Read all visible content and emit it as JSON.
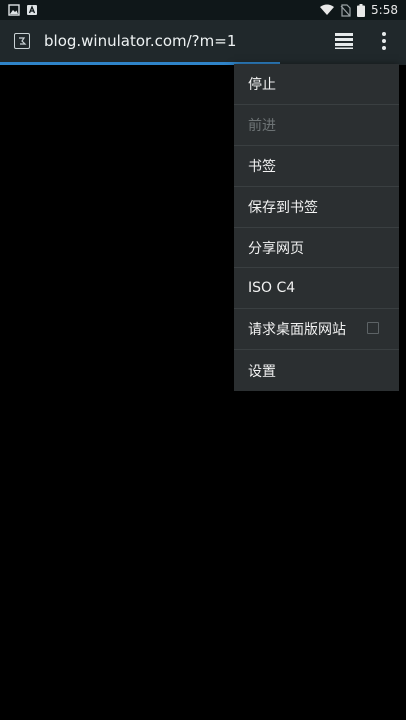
{
  "status_bar": {
    "time": "5:58",
    "left_icons": [
      "image-icon",
      "notification-a-icon"
    ],
    "right_icons": [
      "wifi-icon",
      "no-sim-icon",
      "battery-icon"
    ]
  },
  "app_bar": {
    "site_icon": "page-icon",
    "url": "blog.winulator.com/?m=1",
    "tabs_icon": "tabs-stack-icon",
    "more_icon": "more-vert-icon"
  },
  "progress": {
    "fraction": 0.69,
    "color": "#2f84c9"
  },
  "menu": {
    "items": [
      {
        "label": "停止",
        "enabled": true
      },
      {
        "label": "前进",
        "enabled": false
      },
      {
        "label": "书签",
        "enabled": true
      },
      {
        "label": "保存到书签",
        "enabled": true
      },
      {
        "label": "分享网页",
        "enabled": true
      },
      {
        "label": "ISO C4",
        "enabled": true
      },
      {
        "label": "请求桌面版网站",
        "enabled": true,
        "checkbox": false
      },
      {
        "label": "设置",
        "enabled": true
      }
    ]
  }
}
